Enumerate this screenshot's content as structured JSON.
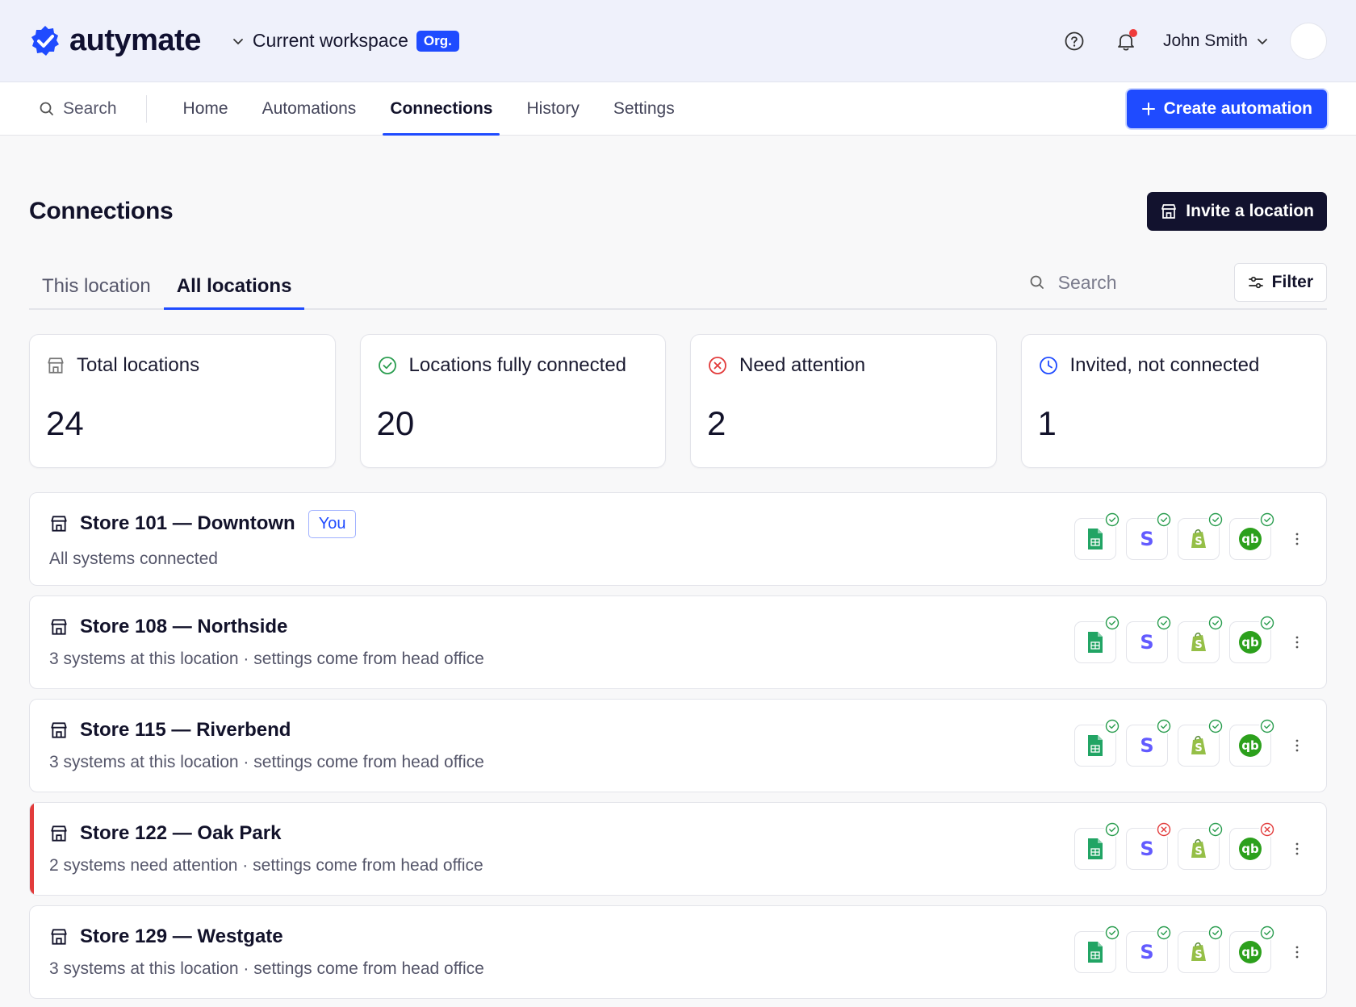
{
  "brand": {
    "name": "autymate",
    "color": "#1f4bff"
  },
  "workspace": {
    "label": "Current workspace",
    "badge": "Org."
  },
  "user": {
    "name": "John Smith"
  },
  "nav": {
    "search_label": "Search",
    "items": [
      {
        "label": "Home",
        "active": false
      },
      {
        "label": "Automations",
        "active": false
      },
      {
        "label": "Connections",
        "active": true
      },
      {
        "label": "History",
        "active": false
      },
      {
        "label": "Settings",
        "active": false
      }
    ],
    "create_label": "Create automation"
  },
  "page": {
    "title": "Connections",
    "invite_label": "Invite a location",
    "tabs": [
      {
        "label": "This location",
        "active": false
      },
      {
        "label": "All locations",
        "active": true
      }
    ],
    "search_placeholder": "Search",
    "filter_label": "Filter"
  },
  "stats": [
    {
      "label": "Total locations",
      "value": "24",
      "icon": "store-icon"
    },
    {
      "label": "Locations fully connected",
      "value": "20",
      "icon": "check-circle-icon"
    },
    {
      "label": "Need attention",
      "value": "2",
      "icon": "x-circle-icon"
    },
    {
      "label": "Invited, not connected",
      "value": "1",
      "icon": "clock-icon"
    }
  ],
  "apps": [
    "google-sheets-icon",
    "stripe-icon",
    "shopify-icon",
    "quickbooks-icon"
  ],
  "locations": [
    {
      "name": "Store 101 — Downtown",
      "badge": "You",
      "subtitle": "All systems connected",
      "alert": false,
      "statuses": [
        "ok",
        "ok",
        "ok",
        "ok"
      ]
    },
    {
      "name": "Store 108 — Northside",
      "badge": "",
      "subtitle": "3 systems at this location · settings come from head office",
      "alert": false,
      "statuses": [
        "ok",
        "ok",
        "ok",
        "ok"
      ]
    },
    {
      "name": "Store 115 — Riverbend",
      "badge": "",
      "subtitle": "3 systems at this location · settings come from head office",
      "alert": false,
      "statuses": [
        "ok",
        "ok",
        "ok",
        "ok"
      ]
    },
    {
      "name": "Store 122 — Oak Park",
      "badge": "",
      "subtitle": "2 systems need attention · settings come from head office",
      "alert": true,
      "statuses": [
        "ok",
        "error",
        "ok",
        "error"
      ]
    },
    {
      "name": "Store 129 — Westgate",
      "badge": "",
      "subtitle": "3 systems at this location · settings come from head office",
      "alert": false,
      "statuses": [
        "ok",
        "ok",
        "ok",
        "ok"
      ]
    }
  ],
  "colors": {
    "ok": "#2a9d4f",
    "error": "#e23b3b",
    "primary": "#1f4bff",
    "dark": "#12122e"
  }
}
